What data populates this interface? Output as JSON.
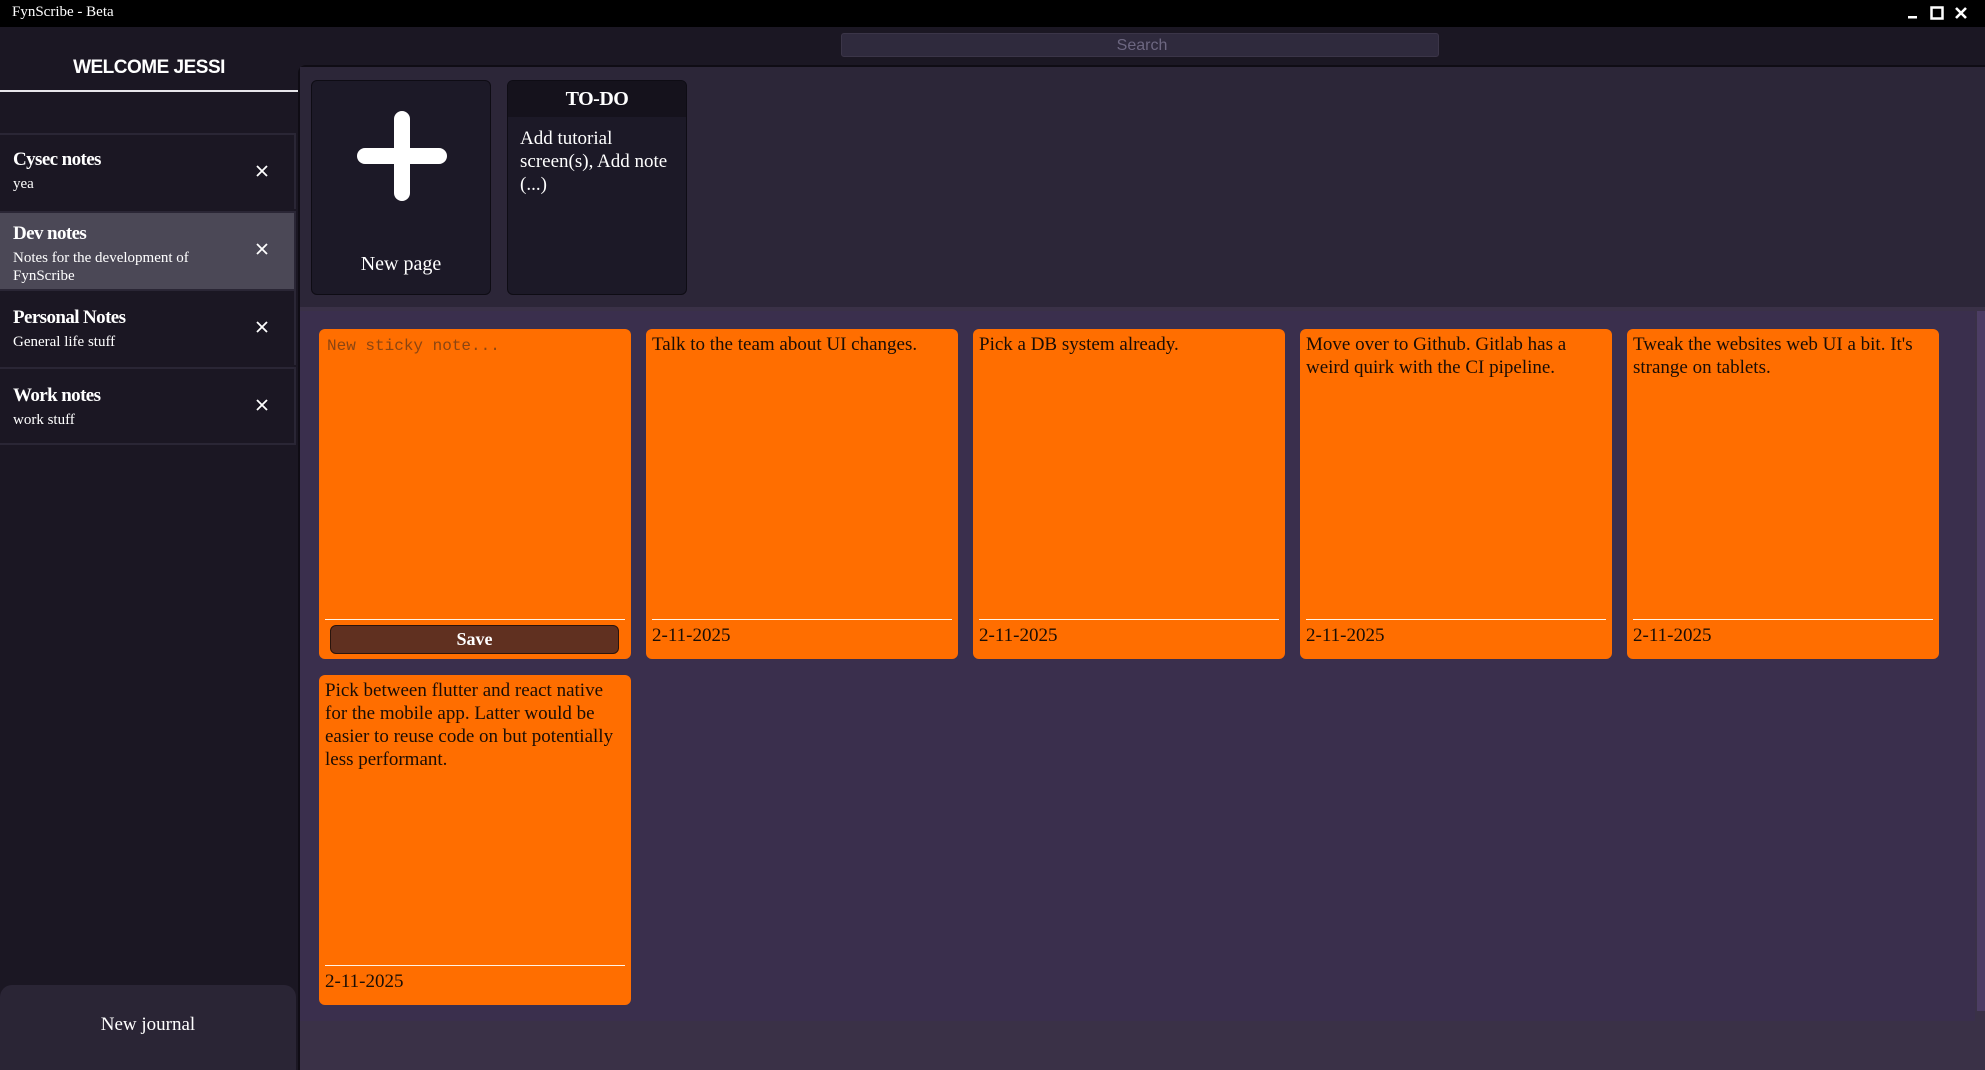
{
  "window": {
    "title": "FynScribe - Beta"
  },
  "sidebar": {
    "welcome": "WELCOME JESSI",
    "journals": [
      {
        "title": "Cysec notes",
        "description": "yea"
      },
      {
        "title": "Dev notes",
        "description": "Notes for the development of FynScribe"
      },
      {
        "title": "Personal Notes",
        "description": "General life stuff"
      },
      {
        "title": "Work notes",
        "description": "work stuff"
      }
    ],
    "active_journal": "Dev notes",
    "new_journal_label": "New journal"
  },
  "search": {
    "placeholder": "Search",
    "value": ""
  },
  "pages": {
    "new_page_label": "New page",
    "todo": {
      "title": "TO-DO",
      "body": "Add tutorial screen(s), Add note (...)"
    }
  },
  "sticky_notes": {
    "new_placeholder": "New sticky note...",
    "save_label": "Save",
    "notes": [
      {
        "text": "Talk to the team about UI changes.",
        "date": "2-11-2025"
      },
      {
        "text": "Pick a DB system already.",
        "date": "2-11-2025"
      },
      {
        "text": "Move over to Github. Gitlab has a weird quirk with the CI pipeline.",
        "date": "2-11-2025"
      },
      {
        "text": "Tweak the websites web UI a bit. It's strange on tablets.",
        "date": "2-11-2025"
      },
      {
        "text": "Pick between flutter and react native for the mobile app. Latter would be easier to reuse code on but potentially less performant.",
        "date": "2-11-2025"
      }
    ]
  },
  "colors": {
    "note": "#ff6e00",
    "sidebar": "#1b1723",
    "main": "#3a2f4d",
    "save_button": "#603020"
  }
}
